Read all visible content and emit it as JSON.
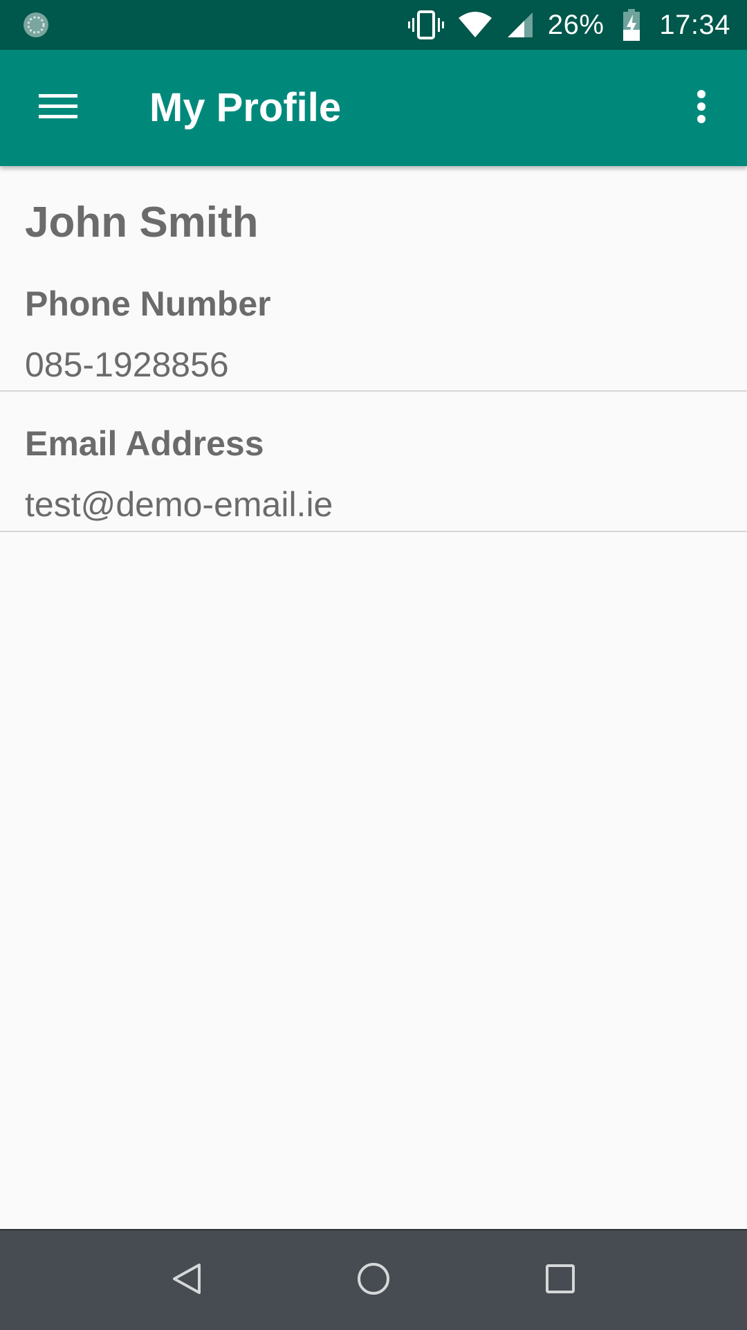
{
  "status_bar": {
    "battery_percent": "26%",
    "time": "17:34",
    "icons": {
      "left": "sync-icon",
      "vibrate": "vibrate-icon",
      "wifi": "wifi-icon",
      "signal": "signal-icon",
      "battery": "battery-charging-icon"
    }
  },
  "app_bar": {
    "title": "My Profile",
    "menu_icon": "hamburger-menu-icon",
    "overflow_icon": "more-vert-icon",
    "color": "#00897b"
  },
  "profile": {
    "name": "John Smith",
    "phone_label": "Phone Number",
    "phone_value": "085-1928856",
    "email_label": "Email Address",
    "email_value": "test@demo-email.ie"
  },
  "nav_bar": {
    "back_icon": "back-triangle-icon",
    "home_icon": "home-circle-icon",
    "recents_icon": "recents-square-icon"
  }
}
